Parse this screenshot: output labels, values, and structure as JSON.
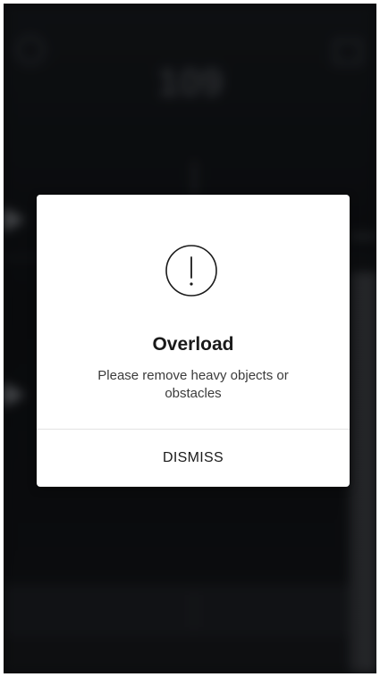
{
  "dialog": {
    "icon": "exclamation-circle-icon",
    "title": "Overload",
    "message": "Please remove heavy objects or obstacles",
    "dismiss_label": "DISMISS"
  },
  "background": {
    "big_number": "109"
  },
  "colors": {
    "dialog_bg": "#ffffff",
    "overlay": "#0f1114",
    "text_primary": "#1a1a1a"
  }
}
